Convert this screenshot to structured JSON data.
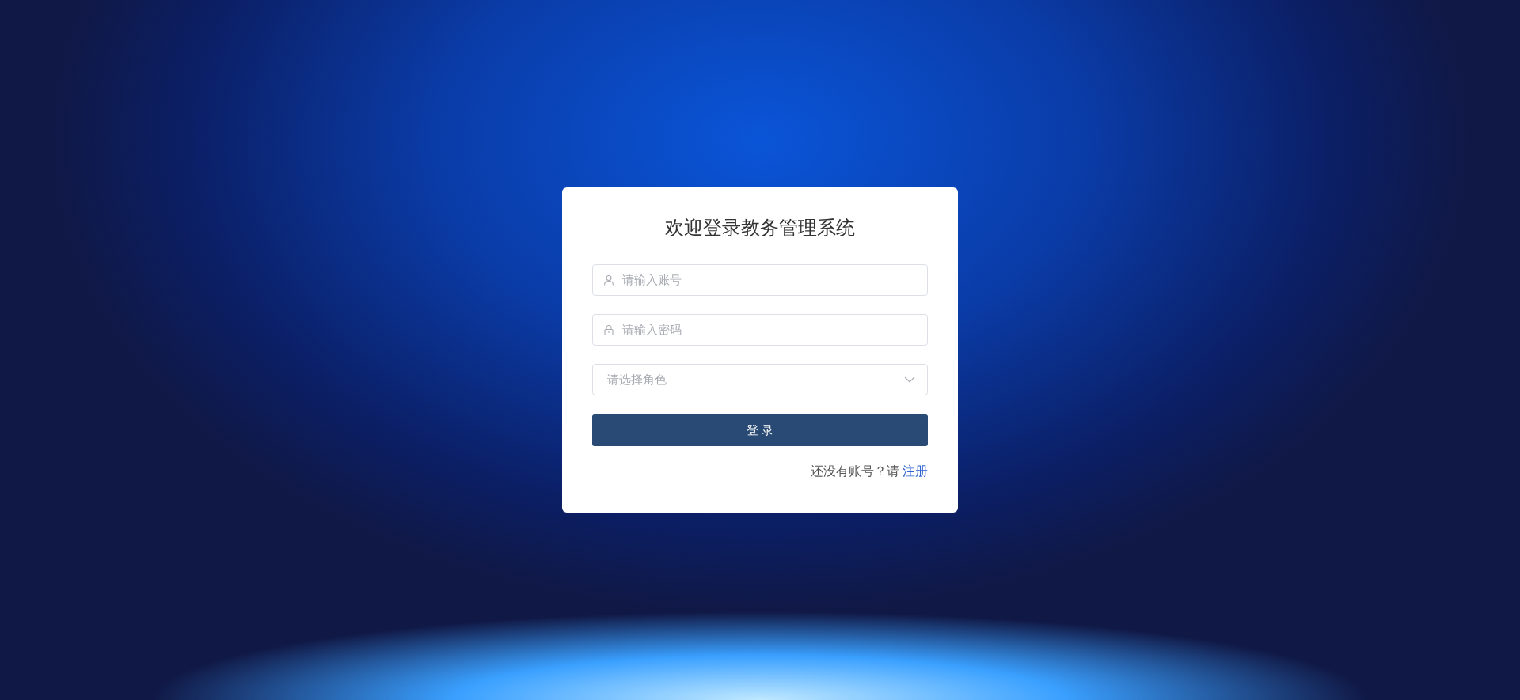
{
  "login_card": {
    "title": "欢迎登录教务管理系统",
    "fields": [
      {
        "kind": "text",
        "placeholder": "请输入账号"
      },
      {
        "kind": "password",
        "placeholder": "请输入密码"
      },
      {
        "kind": "select",
        "placeholder": "请选择角色"
      }
    ],
    "submit_button": "登 录",
    "footer": {
      "prompt": "还没有账号？请",
      "link": "注册"
    }
  }
}
